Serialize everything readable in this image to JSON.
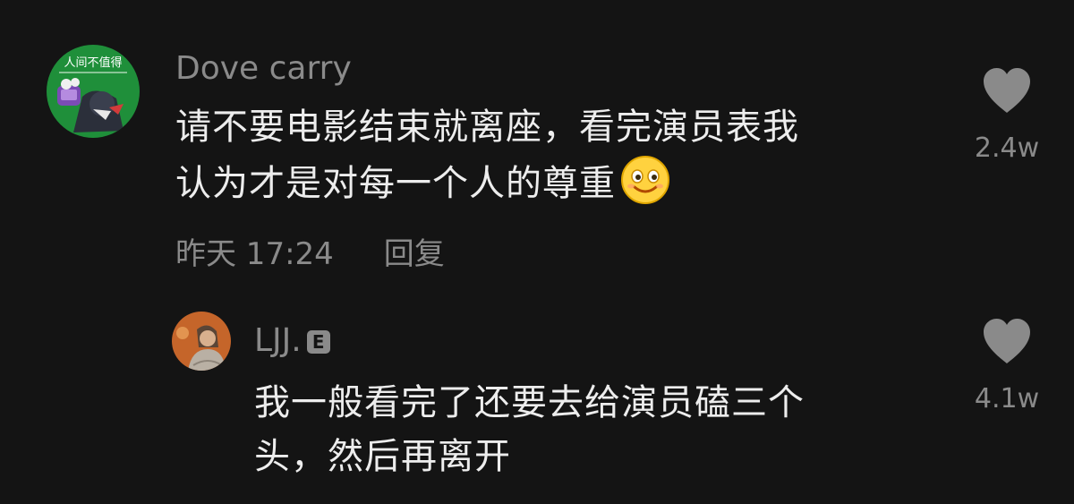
{
  "comments": [
    {
      "username": "Dove carry",
      "text_line1": "请不要电影结束就离座，看完演员表我",
      "text_line2": "认为才是对每一个人的尊重",
      "emoji": "smiling-face-emoji",
      "timestamp": "昨天 17:24",
      "reply_label": "回复",
      "like_count": "2.4w",
      "like_icon": "heart-icon",
      "avatar_text": "人间不值得"
    }
  ],
  "replies": [
    {
      "username": "LJJ.",
      "badge": "E",
      "text_line1": "我一般看完了还要去给演员磕三个",
      "text_line2": "头，然后再离开",
      "like_count": "4.1w",
      "like_icon": "heart-icon"
    }
  ],
  "colors": {
    "background": "#141414",
    "primary_text": "#ededed",
    "secondary_text": "#8a8a8a",
    "heart": "#8a8a8a"
  }
}
